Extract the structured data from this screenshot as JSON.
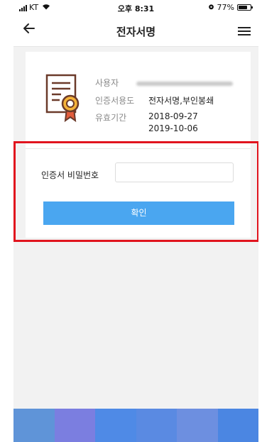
{
  "status_bar": {
    "carrier": "KT",
    "time": "오후 8:31",
    "battery_percent": "77%",
    "battery_level": 0.77
  },
  "header": {
    "title": "전자서명"
  },
  "certificate": {
    "user_label": "사용자",
    "usage_label": "인증서용도",
    "usage_value": "전자서명,부인봉쇄",
    "validity_label": "유효기간",
    "valid_from": "2018-09-27",
    "valid_to": "2019-10-06"
  },
  "password": {
    "label": "인증서 비밀번호",
    "placeholder": ""
  },
  "confirm_label": "확인",
  "colors": {
    "accent": "#4aa6f0",
    "highlight_border": "#e1141e",
    "bottom_bar": [
      "#5f94d8",
      "#7b7ee0",
      "#4f8ae6",
      "#5a8ae2",
      "#6d8fe0",
      "#4b86e2"
    ]
  }
}
